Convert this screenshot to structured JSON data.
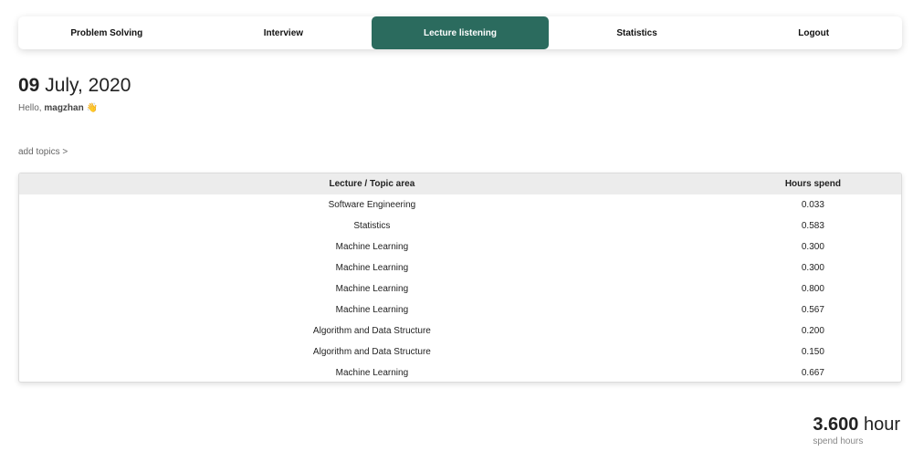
{
  "nav": {
    "items": [
      {
        "label": "Problem Solving",
        "active": false
      },
      {
        "label": "Interview",
        "active": false
      },
      {
        "label": "Lecture listening",
        "active": true
      },
      {
        "label": "Statistics",
        "active": false
      },
      {
        "label": "Logout",
        "active": false
      }
    ],
    "active_color": "#2b6b5e"
  },
  "header": {
    "day": "09",
    "month_year": "July, 2020",
    "greeting": "Hello,",
    "username": "magzhan",
    "wave": "👋"
  },
  "add_topics_label": "add topics >",
  "table": {
    "headers": [
      "Lecture / Topic area",
      "Hours spend"
    ],
    "rows": [
      [
        "Software Engineering",
        "0.033"
      ],
      [
        "Statistics",
        "0.583"
      ],
      [
        "Machine Learning",
        "0.300"
      ],
      [
        "Machine Learning",
        "0.300"
      ],
      [
        "Machine Learning",
        "0.800"
      ],
      [
        "Machine Learning",
        "0.567"
      ],
      [
        "Algorithm and Data Structure",
        "0.200"
      ],
      [
        "Algorithm and Data Structure",
        "0.150"
      ],
      [
        "Machine Learning",
        "0.667"
      ]
    ]
  },
  "total": {
    "value": "3.600",
    "unit": "hour",
    "caption": "spend hours"
  }
}
